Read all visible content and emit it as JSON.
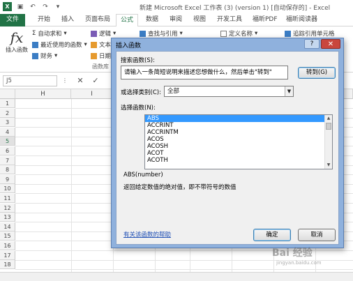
{
  "window": {
    "title": "新建 Microsoft Excel 工作表 (3) (version 1) [自动保存的] - Excel"
  },
  "tabs": [
    "文件",
    "开始",
    "插入",
    "页面布局",
    "公式",
    "数据",
    "审阅",
    "视图",
    "开发工具",
    "福昕PDF",
    "福昕阅读器"
  ],
  "active_tab": "公式",
  "ribbon": {
    "insert_function": "插入函数",
    "autosum": "自动求和",
    "recent": "最近使用的函数",
    "financial": "财务",
    "logical": "逻辑",
    "text": "文本",
    "datetime": "日期",
    "lookup": "查找与引用",
    "define_name": "定义名称",
    "trace_precedents": "追踪引用单元格",
    "group_label": "函数库"
  },
  "formula_bar": {
    "name_box": "J5"
  },
  "grid": {
    "columns": [
      "H",
      "I"
    ],
    "rows": [
      "1",
      "2",
      "3",
      "4",
      "5",
      "6",
      "7",
      "8",
      "9",
      "10",
      "11",
      "12",
      "13",
      "14",
      "15",
      "16",
      "17",
      "18"
    ],
    "selected_row": "5"
  },
  "dialog": {
    "title": "插入函数",
    "help_button": "?",
    "close_button": "✕",
    "search_label": "搜索函数(S):",
    "search_value": "请输入一条简短说明来描述您想做什么，然后单击\"转到\"",
    "goto_button": "转到(G)",
    "category_label": "或选择类别(C):",
    "category_value": "全部",
    "function_label": "选择函数(N):",
    "functions": [
      "ABS",
      "ACCRINT",
      "ACCRINTM",
      "ACOS",
      "ACOSH",
      "ACOT",
      "ACOTH"
    ],
    "selected_function": "ABS",
    "syntax": "ABS(number)",
    "description": "返回给定数值的绝对值，即不带符号的数值",
    "help_link": "有关该函数的帮助",
    "ok_button": "确定",
    "cancel_button": "取消"
  },
  "colors": {
    "excel_green": "#217346",
    "dialog_frame": "#8fb1dd",
    "selection_blue": "#3399ff",
    "close_red": "#c9463d"
  }
}
